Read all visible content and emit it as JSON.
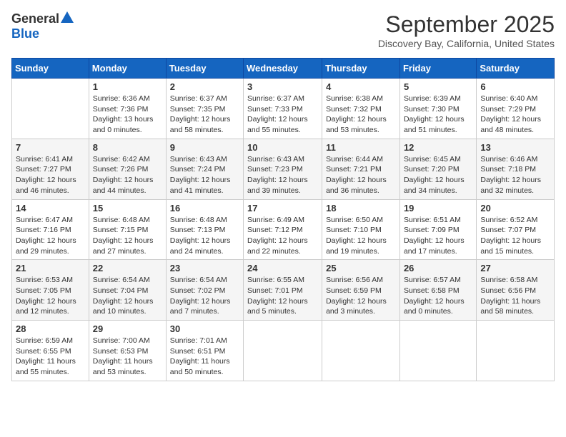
{
  "logo": {
    "general": "General",
    "blue": "Blue"
  },
  "title": "September 2025",
  "location": "Discovery Bay, California, United States",
  "days_of_week": [
    "Sunday",
    "Monday",
    "Tuesday",
    "Wednesday",
    "Thursday",
    "Friday",
    "Saturday"
  ],
  "weeks": [
    [
      {
        "day": "",
        "sunrise": "",
        "sunset": "",
        "daylight": ""
      },
      {
        "day": "1",
        "sunrise": "Sunrise: 6:36 AM",
        "sunset": "Sunset: 7:36 PM",
        "daylight": "Daylight: 13 hours and 0 minutes."
      },
      {
        "day": "2",
        "sunrise": "Sunrise: 6:37 AM",
        "sunset": "Sunset: 7:35 PM",
        "daylight": "Daylight: 12 hours and 58 minutes."
      },
      {
        "day": "3",
        "sunrise": "Sunrise: 6:37 AM",
        "sunset": "Sunset: 7:33 PM",
        "daylight": "Daylight: 12 hours and 55 minutes."
      },
      {
        "day": "4",
        "sunrise": "Sunrise: 6:38 AM",
        "sunset": "Sunset: 7:32 PM",
        "daylight": "Daylight: 12 hours and 53 minutes."
      },
      {
        "day": "5",
        "sunrise": "Sunrise: 6:39 AM",
        "sunset": "Sunset: 7:30 PM",
        "daylight": "Daylight: 12 hours and 51 minutes."
      },
      {
        "day": "6",
        "sunrise": "Sunrise: 6:40 AM",
        "sunset": "Sunset: 7:29 PM",
        "daylight": "Daylight: 12 hours and 48 minutes."
      }
    ],
    [
      {
        "day": "7",
        "sunrise": "Sunrise: 6:41 AM",
        "sunset": "Sunset: 7:27 PM",
        "daylight": "Daylight: 12 hours and 46 minutes."
      },
      {
        "day": "8",
        "sunrise": "Sunrise: 6:42 AM",
        "sunset": "Sunset: 7:26 PM",
        "daylight": "Daylight: 12 hours and 44 minutes."
      },
      {
        "day": "9",
        "sunrise": "Sunrise: 6:43 AM",
        "sunset": "Sunset: 7:24 PM",
        "daylight": "Daylight: 12 hours and 41 minutes."
      },
      {
        "day": "10",
        "sunrise": "Sunrise: 6:43 AM",
        "sunset": "Sunset: 7:23 PM",
        "daylight": "Daylight: 12 hours and 39 minutes."
      },
      {
        "day": "11",
        "sunrise": "Sunrise: 6:44 AM",
        "sunset": "Sunset: 7:21 PM",
        "daylight": "Daylight: 12 hours and 36 minutes."
      },
      {
        "day": "12",
        "sunrise": "Sunrise: 6:45 AM",
        "sunset": "Sunset: 7:20 PM",
        "daylight": "Daylight: 12 hours and 34 minutes."
      },
      {
        "day": "13",
        "sunrise": "Sunrise: 6:46 AM",
        "sunset": "Sunset: 7:18 PM",
        "daylight": "Daylight: 12 hours and 32 minutes."
      }
    ],
    [
      {
        "day": "14",
        "sunrise": "Sunrise: 6:47 AM",
        "sunset": "Sunset: 7:16 PM",
        "daylight": "Daylight: 12 hours and 29 minutes."
      },
      {
        "day": "15",
        "sunrise": "Sunrise: 6:48 AM",
        "sunset": "Sunset: 7:15 PM",
        "daylight": "Daylight: 12 hours and 27 minutes."
      },
      {
        "day": "16",
        "sunrise": "Sunrise: 6:48 AM",
        "sunset": "Sunset: 7:13 PM",
        "daylight": "Daylight: 12 hours and 24 minutes."
      },
      {
        "day": "17",
        "sunrise": "Sunrise: 6:49 AM",
        "sunset": "Sunset: 7:12 PM",
        "daylight": "Daylight: 12 hours and 22 minutes."
      },
      {
        "day": "18",
        "sunrise": "Sunrise: 6:50 AM",
        "sunset": "Sunset: 7:10 PM",
        "daylight": "Daylight: 12 hours and 19 minutes."
      },
      {
        "day": "19",
        "sunrise": "Sunrise: 6:51 AM",
        "sunset": "Sunset: 7:09 PM",
        "daylight": "Daylight: 12 hours and 17 minutes."
      },
      {
        "day": "20",
        "sunrise": "Sunrise: 6:52 AM",
        "sunset": "Sunset: 7:07 PM",
        "daylight": "Daylight: 12 hours and 15 minutes."
      }
    ],
    [
      {
        "day": "21",
        "sunrise": "Sunrise: 6:53 AM",
        "sunset": "Sunset: 7:05 PM",
        "daylight": "Daylight: 12 hours and 12 minutes."
      },
      {
        "day": "22",
        "sunrise": "Sunrise: 6:54 AM",
        "sunset": "Sunset: 7:04 PM",
        "daylight": "Daylight: 12 hours and 10 minutes."
      },
      {
        "day": "23",
        "sunrise": "Sunrise: 6:54 AM",
        "sunset": "Sunset: 7:02 PM",
        "daylight": "Daylight: 12 hours and 7 minutes."
      },
      {
        "day": "24",
        "sunrise": "Sunrise: 6:55 AM",
        "sunset": "Sunset: 7:01 PM",
        "daylight": "Daylight: 12 hours and 5 minutes."
      },
      {
        "day": "25",
        "sunrise": "Sunrise: 6:56 AM",
        "sunset": "Sunset: 6:59 PM",
        "daylight": "Daylight: 12 hours and 3 minutes."
      },
      {
        "day": "26",
        "sunrise": "Sunrise: 6:57 AM",
        "sunset": "Sunset: 6:58 PM",
        "daylight": "Daylight: 12 hours and 0 minutes."
      },
      {
        "day": "27",
        "sunrise": "Sunrise: 6:58 AM",
        "sunset": "Sunset: 6:56 PM",
        "daylight": "Daylight: 11 hours and 58 minutes."
      }
    ],
    [
      {
        "day": "28",
        "sunrise": "Sunrise: 6:59 AM",
        "sunset": "Sunset: 6:55 PM",
        "daylight": "Daylight: 11 hours and 55 minutes."
      },
      {
        "day": "29",
        "sunrise": "Sunrise: 7:00 AM",
        "sunset": "Sunset: 6:53 PM",
        "daylight": "Daylight: 11 hours and 53 minutes."
      },
      {
        "day": "30",
        "sunrise": "Sunrise: 7:01 AM",
        "sunset": "Sunset: 6:51 PM",
        "daylight": "Daylight: 11 hours and 50 minutes."
      },
      {
        "day": "",
        "sunrise": "",
        "sunset": "",
        "daylight": ""
      },
      {
        "day": "",
        "sunrise": "",
        "sunset": "",
        "daylight": ""
      },
      {
        "day": "",
        "sunrise": "",
        "sunset": "",
        "daylight": ""
      },
      {
        "day": "",
        "sunrise": "",
        "sunset": "",
        "daylight": ""
      }
    ]
  ]
}
